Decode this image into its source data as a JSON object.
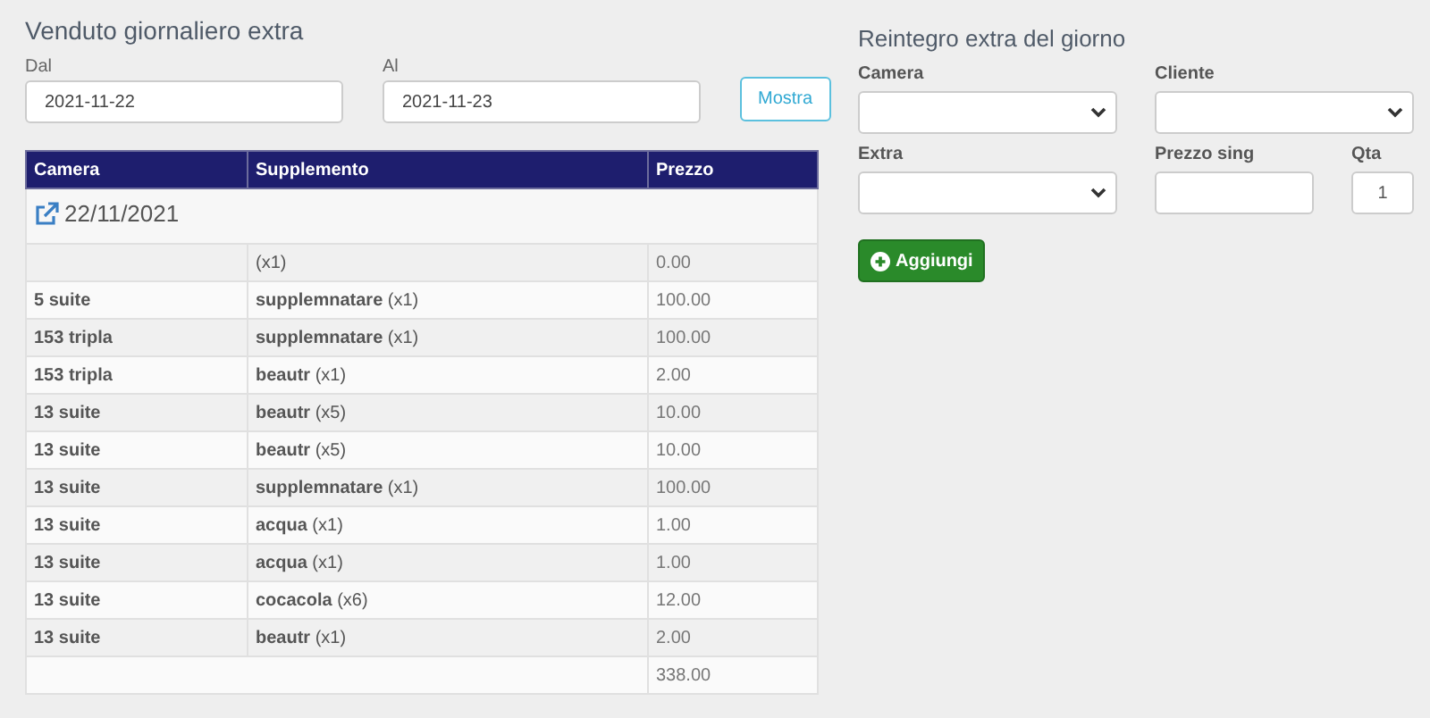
{
  "title": "Venduto giornaliero extra",
  "filters": [
    {
      "label": "Dal",
      "value": "2021-11-22"
    },
    {
      "label": "Al",
      "value": "2021-11-23"
    }
  ],
  "show_button": "Mostra",
  "table": {
    "columns": [
      "Camera",
      "Supplemento",
      "Prezzo"
    ],
    "date_group": "22/11/2021",
    "rows": [
      {
        "supplemento": "(x1)",
        "prezzo": "0.00"
      },
      {
        "camera": "5 suite",
        "supplemento": "**supplemnatare** (x1)",
        "prezzo": "100.00"
      },
      {
        "camera": "153 tripla",
        "supplemento": "**supplemnatare** (x1)",
        "prezzo": "100.00"
      },
      {
        "camera": "153 tripla",
        "supplemento": "**beautr** (x1)",
        "prezzo": "2.00"
      },
      {
        "camera": "13 suite",
        "supplemento": "**beautr** (x5)",
        "prezzo": "10.00"
      },
      {
        "camera": "13 suite",
        "supplemento": "**beautr** (x5)",
        "prezzo": "10.00"
      },
      {
        "camera": "13 suite",
        "supplemento": "**supplemnatare** (x1)",
        "prezzo": "100.00"
      },
      {
        "camera": "13 suite",
        "supplemento": "**acqua** (x1)",
        "prezzo": "1.00"
      },
      {
        "camera": "13 suite",
        "supplemento": "**acqua** (x1)",
        "prezzo": "1.00"
      },
      {
        "camera": "13 suite",
        "supplemento": "**cocacola** (x6)",
        "prezzo": "12.00"
      },
      {
        "camera": "13 suite",
        "supplemento": "**beautr** (x1)",
        "prezzo": "2.00"
      }
    ],
    "total": "338.00"
  },
  "form": {
    "title": "Reintegro extra del giorno",
    "fields": [
      {
        "label": "Camera",
        "kind": "select"
      },
      {
        "label": "Cliente",
        "kind": "select"
      },
      {
        "label": "Extra",
        "kind": "select"
      },
      {
        "label": "Prezzo sing",
        "kind": "input"
      },
      {
        "label": "Qta",
        "kind": "input",
        "value": "1"
      }
    ],
    "add_button": "Aggiungi"
  }
}
